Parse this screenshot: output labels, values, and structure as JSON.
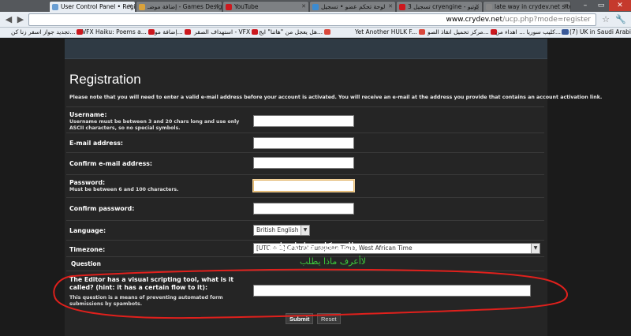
{
  "browser": {
    "tabs": [
      {
        "label": "User Control Panel • Regis",
        "active": true,
        "favicon_color": "#6a9fd4"
      },
      {
        "label": "إضافة موضـ - Games Design",
        "active": false,
        "favicon_color": "#d9a23b"
      },
      {
        "label": "YouTube",
        "active": false,
        "favicon_color": "#cc181e"
      },
      {
        "label": "لوحة تحكم عضو • تسجيل",
        "active": false,
        "favicon_color": "#3b8bd1"
      },
      {
        "label": "تسجيل 3 cryengine - يوتيو",
        "active": false,
        "favicon_color": "#cc181e"
      },
      {
        "label": "late way in crydev.net site",
        "active": false,
        "favicon_color": "#888888"
      }
    ],
    "url": {
      "host": "www.crydev.net",
      "path": "/ucp.php?mode=register"
    },
    "bookmarks": [
      {
        "label": "VFX Haiku: Poems a...",
        "icon_color": "#cc181e"
      },
      {
        "label": "إضافة مو...",
        "icon_color": "#cc181e"
      },
      {
        "label": "استهداف الصقر - VFX",
        "icon_color": "#cc181e"
      },
      {
        "label": "هل يعجل من \"هاتنا\" ايج...",
        "icon_color": "#d9473b"
      },
      {
        "label": "Yet Another HULK F...",
        "icon_color": "#d9473b"
      },
      {
        "label": "مركز تحميل انقاذ الصو...",
        "icon_color": "#cc181e"
      },
      {
        "label": "كليب سوريا ... اهداء من...",
        "icon_color": "#2e5ea8"
      },
      {
        "label": "تجديد جواز اسفر زنا كن...",
        "icon_color": "#cc181e"
      },
      {
        "label": "(7) UK in Saudi Arabia",
        "icon_color": "#3b5998"
      }
    ]
  },
  "form": {
    "title": "Registration",
    "notice": "Please note that you will need to enter a valid e-mail address before your account is activated. You will receive an e-mail at the address you provide that contains an account activation link.",
    "username_label": "Username:",
    "username_hint": "Username must be between 3 and 20 chars long and use only ASCII characters, so no special symbols.",
    "email_label": "E-mail address:",
    "confirm_email_label": "Confirm e-mail address:",
    "password_label": "Password:",
    "password_hint": "Must be between 6 and 100 characters.",
    "confirm_password_label": "Confirm password:",
    "language_label": "Language:",
    "language_value": "British English",
    "timezone_label": "Timezone:",
    "timezone_value": "[UTC + 1] Central European Time, West African Time",
    "question_header": "Question",
    "question_text": "The Editor has a visual scripting tool, what is it called? (hint: it has a certain flow to it):",
    "question_hint": "This question is a means of preventing automated form submissions by spambots.",
    "submit_label": "Submit",
    "reset_label": "Reset"
  },
  "annotations": {
    "arabic_white": "المشكلة هنا ياخواني",
    "arabic_green": "لاأعرف ماذا يطلب",
    "loop_color": "#e0201c"
  }
}
